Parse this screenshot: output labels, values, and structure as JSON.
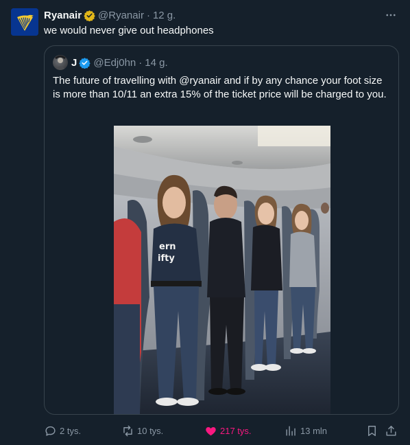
{
  "tweet": {
    "author_name": "Ryanair",
    "handle": "@Ryanair",
    "separator": "·",
    "time": "12 g.",
    "text": "we would never give out headphones",
    "avatar_icon": "ryanair-harp-logo",
    "verified_icon": "gold-verified-badge"
  },
  "quote": {
    "author_name": "J",
    "handle": "@Edj0hn",
    "separator": "·",
    "time": "14 g.",
    "text": "The  future of travelling with @ryanair and if by any chance  your foot size is more than 10/11  an extra 15% of the ticket price will be charged to you.",
    "verified_icon": "blue-verified-badge",
    "image_icon": "airplane-cabin-standing-passengers-photo"
  },
  "actions": {
    "replies": "2 tys.",
    "reposts": "10 tys.",
    "likes": "217 tys.",
    "views": "13 mln"
  },
  "colors": {
    "background": "#15202b",
    "text": "#f7f9f9",
    "muted": "#8b98a5",
    "border": "#38444d",
    "like": "#f91880",
    "verified_gold": "#e2b719",
    "verified_blue": "#1d9bf0",
    "ryanair_blue": "#073590",
    "ryanair_yellow": "#f1c933"
  }
}
